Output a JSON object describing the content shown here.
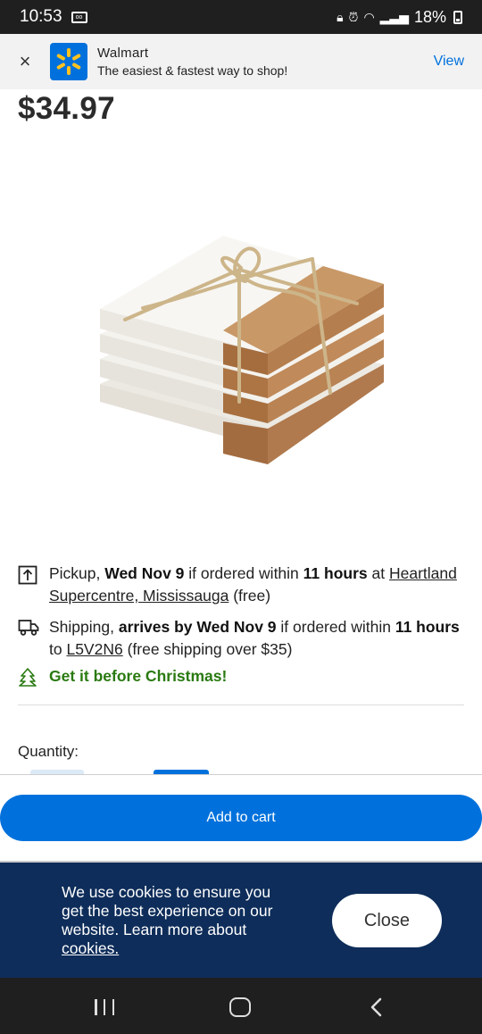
{
  "status_bar": {
    "time": "10:53",
    "battery": "18%"
  },
  "app_banner": {
    "title": "Walmart",
    "subtitle": "The easiest & fastest way to shop!",
    "view_label": "View",
    "close_label": "×"
  },
  "product": {
    "price": "$34.97"
  },
  "pickup": {
    "prefix": "Pickup, ",
    "date": "Wed Nov 9",
    "mid": " if ordered within ",
    "hours": "11 hours",
    "at": " at ",
    "store": "Heartland Supercentre, Mississauga",
    "suffix": " (free)"
  },
  "shipping": {
    "prefix": "Shipping, ",
    "arrives": "arrives by Wed Nov 9",
    "mid": " if ordered within ",
    "hours": "11 hours",
    "to": " to ",
    "postal": "L5V2N6",
    "suffix": " (free shipping over $35)"
  },
  "christmas": {
    "label": "Get it before Christmas!"
  },
  "quantity": {
    "label": "Quantity:"
  },
  "cart": {
    "button_label": "Add to cart"
  },
  "cookie_banner": {
    "text": "We use cookies to ensure you get the best experience on our website. Learn more about ",
    "link": "cookies.",
    "close_label": "Close"
  },
  "colors": {
    "brand_blue": "#0071dc",
    "spark_yellow": "#ffc220",
    "cookie_bg": "#0e2d5a",
    "christmas_green": "#2a7a12"
  }
}
